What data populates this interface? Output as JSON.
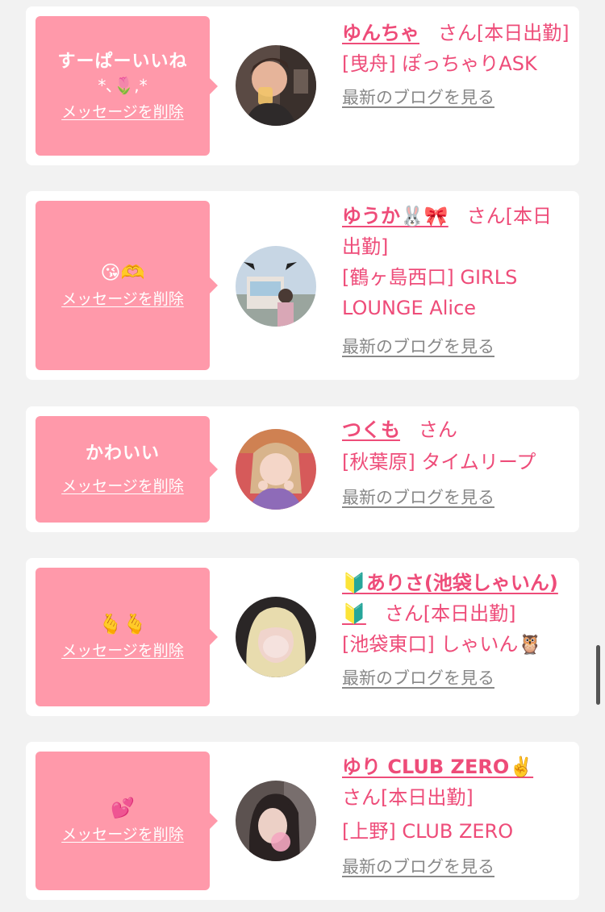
{
  "common": {
    "delete_label": "メッセージを削除",
    "san_label": "さん",
    "blog_label": "最新のブログを見る"
  },
  "items": [
    {
      "message": "すーぱーいいね",
      "message_emoji": "*､🌷,*",
      "name": "ゆんちゃ",
      "status": "[本日出勤]",
      "shop": "[曳舟] ぽっちゃりASK",
      "avatar_icon": "avatar-photo"
    },
    {
      "message": "",
      "message_emoji": "😘🫶",
      "name": "ゆうか🐰🎀",
      "status": "[本日出勤]",
      "shop": "[鶴ヶ島西口] GIRLS LOUNGE Alice",
      "avatar_icon": "avatar-photo"
    },
    {
      "message": "かわいい",
      "message_emoji": "",
      "name": "つくも",
      "status": "",
      "shop": "[秋葉原] タイムリープ",
      "avatar_icon": "avatar-photo"
    },
    {
      "message": "",
      "message_emoji": "🫰🫰",
      "name": "🔰ありさ(池袋しゃいん)🔰",
      "status": "[本日出勤]",
      "shop": "[池袋東口] しゃいん🦉",
      "avatar_icon": "avatar-photo"
    },
    {
      "message": "",
      "message_emoji": "💕",
      "name": "ゆり CLUB ZERO✌️",
      "status": "[本日出勤]",
      "shop": "[上野] CLUB ZERO",
      "avatar_icon": "avatar-photo"
    }
  ],
  "colors": {
    "accent": "#ee4c79",
    "bubble": "#ff99aa",
    "background": "#f2f2f2",
    "link_gray": "#888888"
  }
}
